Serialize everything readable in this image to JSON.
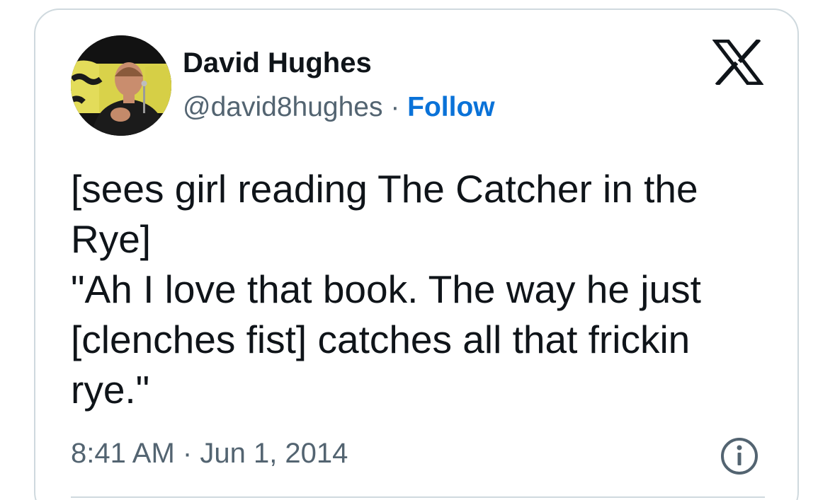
{
  "tweet": {
    "author_name": "David Hughes",
    "handle": "@david8hughes",
    "separator": "·",
    "follow_label": "Follow",
    "text_lines": [
      "[sees girl reading The Catcher in the",
      "Rye]",
      "\"Ah I love that book. The way he just",
      "[clenches fist] catches all that frickin",
      "rye.\""
    ],
    "time": "8:41 AM",
    "date": "Jun 1, 2014"
  },
  "icons": {
    "platform_logo": "x-logo-icon",
    "info": "info-icon"
  },
  "colors": {
    "text": "#0f1419",
    "secondary": "#536471",
    "follow": "#0a72d8",
    "border": "#cfd9de"
  }
}
